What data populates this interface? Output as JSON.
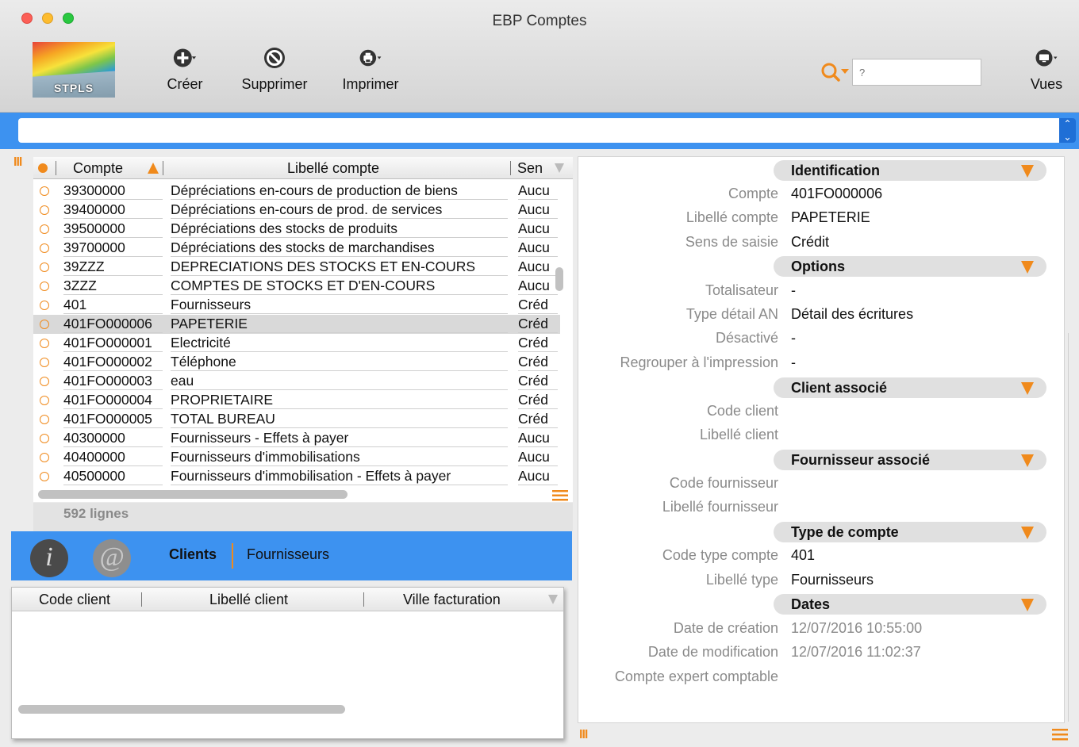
{
  "window": {
    "title": "EBP Comptes"
  },
  "logo": {
    "text": "STPLS"
  },
  "toolbar": {
    "creer": "Créer",
    "supprimer": "Supprimer",
    "imprimer": "Imprimer",
    "vues": "Vues",
    "search_placeholder": "?"
  },
  "accounts": {
    "headers": {
      "compte": "Compte",
      "libelle": "Libellé compte",
      "sens": "Sen"
    },
    "rows": [
      {
        "code": "39300000",
        "libelle": "Dépréciations en-cours de production de biens",
        "sens": "Aucu"
      },
      {
        "code": "39400000",
        "libelle": "Dépréciations en-cours de prod. de services",
        "sens": "Aucu"
      },
      {
        "code": "39500000",
        "libelle": "Dépréciations des stocks de produits",
        "sens": "Aucu"
      },
      {
        "code": "39700000",
        "libelle": "Dépréciations des stocks de marchandises",
        "sens": "Aucu"
      },
      {
        "code": "39ZZZ",
        "libelle": "DEPRECIATIONS DES STOCKS ET EN-COURS",
        "sens": "Aucu"
      },
      {
        "code": "3ZZZ",
        "libelle": "COMPTES DE STOCKS ET D'EN-COURS",
        "sens": "Aucu"
      },
      {
        "code": "401",
        "libelle": "Fournisseurs",
        "sens": "Créd"
      },
      {
        "code": "401FO000006",
        "libelle": "PAPETERIE",
        "sens": "Créd",
        "selected": true
      },
      {
        "code": "401FO000001",
        "libelle": "Electricité",
        "sens": "Créd"
      },
      {
        "code": "401FO000002",
        "libelle": "Téléphone",
        "sens": "Créd"
      },
      {
        "code": "401FO000003",
        "libelle": "eau",
        "sens": "Créd"
      },
      {
        "code": "401FO000004",
        "libelle": "PROPRIETAIRE",
        "sens": "Créd"
      },
      {
        "code": "401FO000005",
        "libelle": "TOTAL BUREAU",
        "sens": "Créd"
      },
      {
        "code": "40300000",
        "libelle": "Fournisseurs - Effets à payer",
        "sens": "Aucu"
      },
      {
        "code": "40400000",
        "libelle": "Fournisseurs d'immobilisations",
        "sens": "Aucu"
      },
      {
        "code": "40500000",
        "libelle": "Fournisseurs d'immobilisation - Effets à payer",
        "sens": "Aucu"
      }
    ],
    "count": "592 lignes"
  },
  "tabs": {
    "info_icon": "i",
    "at_icon": "@",
    "clients": "Clients",
    "fournisseurs": "Fournisseurs"
  },
  "clients_table": {
    "code": "Code client",
    "libelle": "Libellé client",
    "ville": "Ville facturation"
  },
  "detail": {
    "identification": {
      "title": "Identification",
      "compte_label": "Compte",
      "compte": "401FO000006",
      "libelle_label": "Libellé compte",
      "libelle": "PAPETERIE",
      "sens_label": "Sens de saisie",
      "sens": "Crédit"
    },
    "options": {
      "title": "Options",
      "totalisateur_label": "Totalisateur",
      "totalisateur": "-",
      "type_detail_label": "Type détail AN",
      "type_detail": "Détail des écritures",
      "desactive_label": "Désactivé",
      "desactive": "-",
      "regrouper_label": "Regrouper à l'impression",
      "regrouper": "-"
    },
    "client": {
      "title": "Client associé",
      "code_label": "Code client",
      "libelle_label": "Libellé client"
    },
    "fournisseur": {
      "title": "Fournisseur associé",
      "code_label": "Code fournisseur",
      "libelle_label": "Libellé fournisseur"
    },
    "type": {
      "title": "Type de compte",
      "code_label": "Code type compte",
      "code": "401",
      "libelle_label": "Libellé type",
      "libelle": "Fournisseurs"
    },
    "dates": {
      "title": "Dates",
      "creation_label": "Date de création",
      "creation": "12/07/2016 10:55:00",
      "modification_label": "Date de modification",
      "modification": "12/07/2016 11:02:37",
      "expert_label": "Compte expert comptable"
    }
  },
  "colors": {
    "accent": "#f08a1c",
    "blue_bar": "#3d92f0",
    "selection": "#d9d9d9"
  }
}
